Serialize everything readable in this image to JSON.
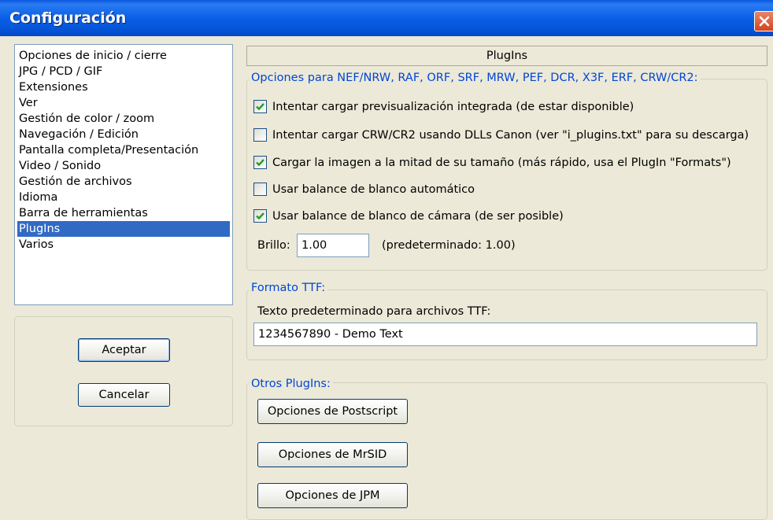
{
  "window": {
    "title": "Configuración"
  },
  "sidebar": {
    "items": [
      {
        "label": "Opciones de inicio / cierre"
      },
      {
        "label": "JPG / PCD / GIF"
      },
      {
        "label": "Extensiones"
      },
      {
        "label": "Ver"
      },
      {
        "label": "Gestión de color / zoom"
      },
      {
        "label": "Navegación / Edición"
      },
      {
        "label": "Pantalla completa/Presentación"
      },
      {
        "label": "Video / Sonido"
      },
      {
        "label": "Gestión de archivos"
      },
      {
        "label": "Idioma"
      },
      {
        "label": "Barra de herramientas"
      },
      {
        "label": "PlugIns"
      },
      {
        "label": "Varios"
      }
    ],
    "selected": "PlugIns"
  },
  "actions": {
    "ok_label": "Aceptar",
    "cancel_label": "Cancelar"
  },
  "panel": {
    "header": "PlugIns",
    "raw_group": {
      "legend": "Opciones para NEF/NRW, RAF, ORF, SRF, MRW, PEF, DCR, X3F, ERF, CRW/CR2:",
      "options": [
        {
          "label": "Intentar cargar previsualización integrada (de estar disponible)",
          "checked": true
        },
        {
          "label": "Intentar cargar CRW/CR2 usando DLLs Canon (ver \"i_plugins.txt\" para su descarga)",
          "checked": false
        },
        {
          "label": "Cargar la imagen a la mitad de su tamaño (más rápido, usa el PlugIn \"Formats\")",
          "checked": true
        },
        {
          "label": "Usar balance de blanco automático",
          "checked": false
        },
        {
          "label": "Usar balance de blanco de cámara (de ser posible)",
          "checked": true
        }
      ],
      "brightness_label": "Brillo:",
      "brightness_value": "1.00",
      "brightness_default": "(predeterminado: 1.00)"
    },
    "ttf_group": {
      "legend": "Formato TTF:",
      "text_label": "Texto predeterminado para archivos TTF:",
      "text_value": "1234567890 - Demo Text"
    },
    "other_group": {
      "legend": "Otros PlugIns:",
      "buttons": [
        {
          "label": "Opciones de Postscript"
        },
        {
          "label": "Opciones de MrSID"
        },
        {
          "label": "Opciones de JPM"
        }
      ]
    }
  },
  "colors": {
    "titlebar": "#0a5fe6",
    "selection": "#316ac5",
    "group_legend": "#0046d5",
    "face": "#ece9d8"
  }
}
